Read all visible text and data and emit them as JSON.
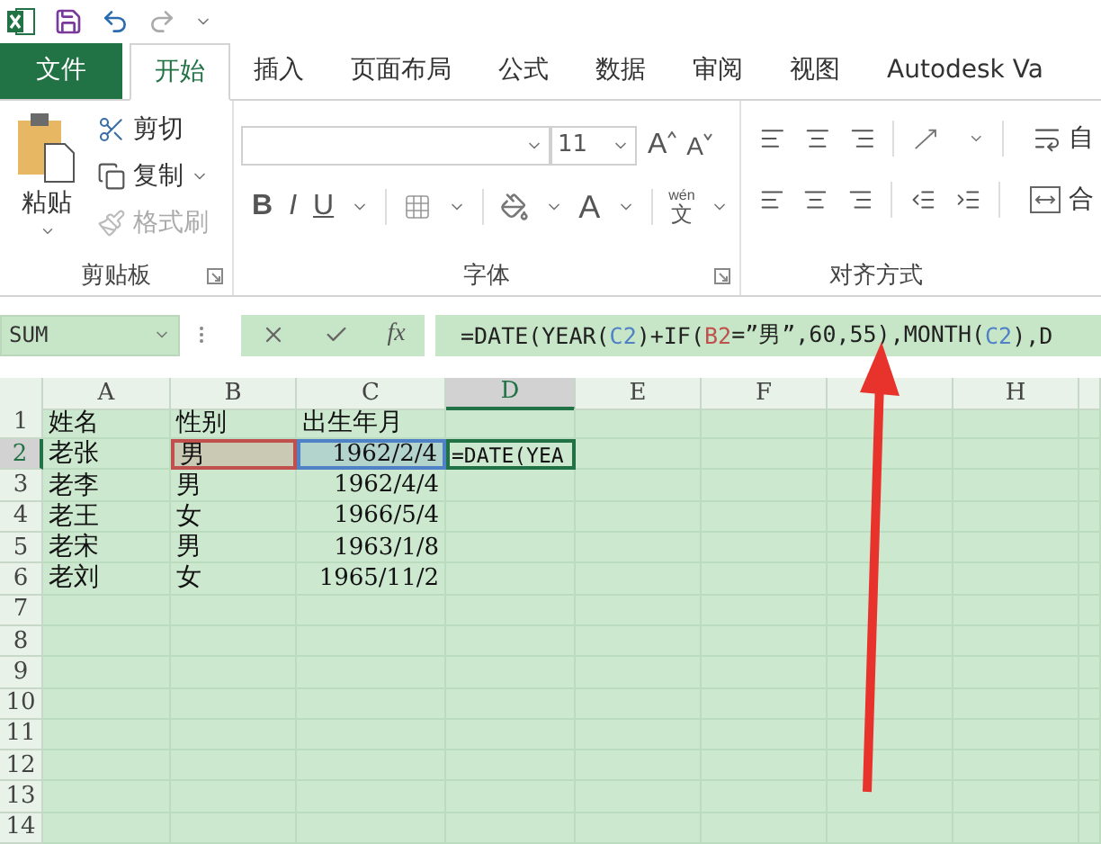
{
  "tabs": [
    {
      "label": "文件",
      "kind": "file",
      "selected": false
    },
    {
      "label": "开始",
      "kind": "tab",
      "selected": true
    },
    {
      "label": "插入",
      "kind": "tab",
      "selected": false
    },
    {
      "label": "页面布局",
      "kind": "tab",
      "selected": false
    },
    {
      "label": "公式",
      "kind": "tab",
      "selected": false
    },
    {
      "label": "数据",
      "kind": "tab",
      "selected": false
    },
    {
      "label": "审阅",
      "kind": "tab",
      "selected": false
    },
    {
      "label": "视图",
      "kind": "tab",
      "selected": false
    },
    {
      "label": "Autodesk Va",
      "kind": "tab",
      "selected": false
    }
  ],
  "clipboard": {
    "label": "剪贴板",
    "paste": "粘贴",
    "cut": "剪切",
    "copy": "复制",
    "format_painter": {
      "label": "格式刷",
      "disabled": true
    }
  },
  "font": {
    "label": "字体",
    "size": "11",
    "bold": "B",
    "italic": "I",
    "underline": "U",
    "font_color": "A",
    "grow": "A",
    "shrink": "A",
    "phonetic_top": "wén",
    "phonetic": "文"
  },
  "alignment": {
    "label": "对齐方式",
    "wrap": "自",
    "merge": "合"
  },
  "name_box": "SUM",
  "fx": "fx",
  "formula": [
    {
      "text": "=DATE(YEAR(",
      "kind": "plain"
    },
    {
      "text": "C2",
      "kind": "ref",
      "color": "#4f81c7"
    },
    {
      "text": ")+IF(",
      "kind": "plain"
    },
    {
      "text": "B2",
      "kind": "ref",
      "color": "#c0504d"
    },
    {
      "text": "=”男”,60,55),MONTH(",
      "kind": "plain"
    },
    {
      "text": "C2",
      "kind": "ref",
      "color": "#4f81c7"
    },
    {
      "text": "),D",
      "kind": "plain"
    }
  ],
  "columns": [
    {
      "label": "A",
      "selected": false
    },
    {
      "label": "B",
      "selected": false
    },
    {
      "label": "C",
      "selected": false
    },
    {
      "label": "D",
      "selected": true
    },
    {
      "label": "E",
      "selected": false
    },
    {
      "label": "F",
      "selected": false
    },
    {
      "selected": false
    },
    {
      "label": "H",
      "selected": false
    }
  ],
  "rows": [
    {
      "number": "1",
      "selected": false,
      "cells": [
        {
          "text": "姓名",
          "kind": "text"
        },
        {
          "text": "性别",
          "kind": "text"
        },
        {
          "text": "出生年月",
          "kind": "text"
        }
      ]
    },
    {
      "number": "2",
      "selected": true,
      "cells": [
        {
          "text": "老张",
          "kind": "text"
        },
        {
          "text": "男",
          "kind": "text",
          "color": "#c0504d"
        },
        {
          "text": "1962/2/4",
          "kind": "date",
          "color": "#4f81c7"
        },
        {
          "text": "=DATE(YEA",
          "kind": "editing"
        }
      ]
    },
    {
      "number": "3",
      "selected": false,
      "cells": [
        {
          "text": "老李",
          "kind": "text"
        },
        {
          "text": "男",
          "kind": "text"
        },
        {
          "text": "1962/4/4",
          "kind": "date"
        }
      ]
    },
    {
      "number": "4",
      "selected": false,
      "cells": [
        {
          "text": "老王",
          "kind": "text"
        },
        {
          "text": "女",
          "kind": "text"
        },
        {
          "text": "1966/5/4",
          "kind": "date"
        }
      ]
    },
    {
      "number": "5",
      "selected": false,
      "cells": [
        {
          "text": "老宋",
          "kind": "text"
        },
        {
          "text": "男",
          "kind": "text"
        },
        {
          "text": "1963/1/8",
          "kind": "date"
        }
      ]
    },
    {
      "number": "6",
      "selected": false,
      "cells": [
        {
          "text": "老刘",
          "kind": "text"
        },
        {
          "text": "女",
          "kind": "text"
        },
        {
          "text": "1965/11/2",
          "kind": "date"
        }
      ]
    },
    {
      "number": "7",
      "selected": false,
      "cells": []
    },
    {
      "number": "8",
      "selected": false,
      "cells": []
    },
    {
      "number": "9",
      "selected": false,
      "cells": []
    },
    {
      "number": "10",
      "selected": false,
      "cells": []
    },
    {
      "number": "11",
      "selected": false,
      "cells": []
    },
    {
      "number": "12",
      "selected": false,
      "cells": []
    },
    {
      "number": "13",
      "selected": false,
      "cells": []
    },
    {
      "number": "14",
      "selected": false,
      "cells": []
    }
  ]
}
